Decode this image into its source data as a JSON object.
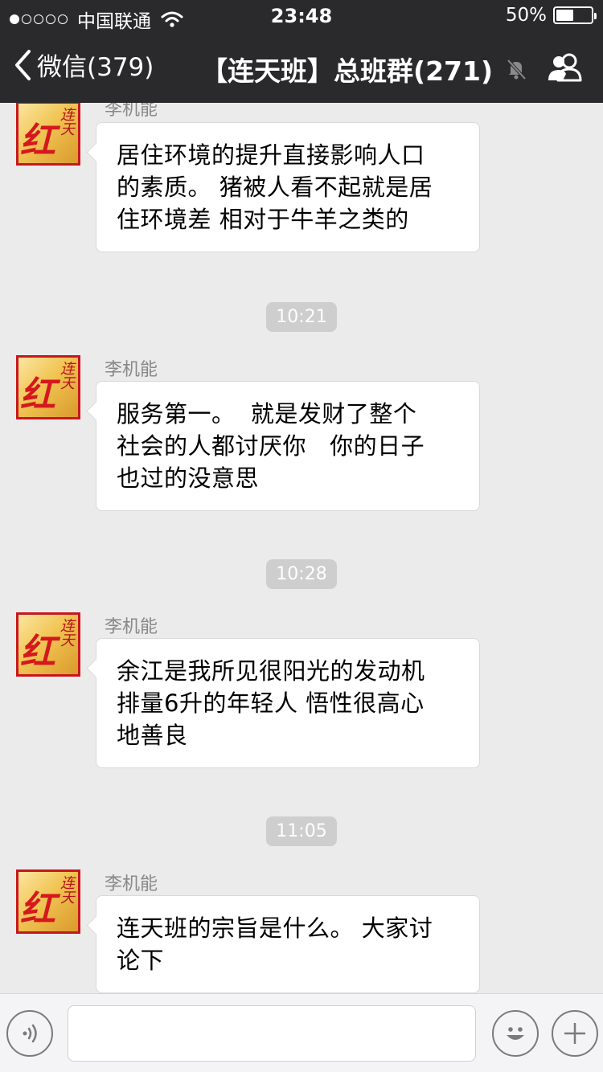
{
  "status_bar": {
    "signal_dots_filled": 1,
    "signal_dots_total": 5,
    "carrier": "中国联通",
    "time": "23:48",
    "battery_percent_text": "50%",
    "battery_level": 0.5
  },
  "nav": {
    "back_label": "微信(379)",
    "title": "【连天班】总班群(271)",
    "icons": [
      "chevron-left-icon",
      "mute-bell-icon",
      "group-members-icon"
    ]
  },
  "avatar": {
    "big_char": "红",
    "small_chars": "连天"
  },
  "timestamps": [
    "10:21",
    "10:28",
    "11:05"
  ],
  "messages": [
    {
      "sender": "李机能",
      "text": "居住环境的提升直接影响人口\n的素质。 猪被人看不起就是居\n住环境差 相对于牛羊之类的"
    },
    {
      "sender": "李机能",
      "text": "服务第一。  就是发财了整个\n社会的人都讨厌你   你的日子\n也过的没意思"
    },
    {
      "sender": "李机能",
      "text": "余江是我所见很阳光的发动机\n排量6升的年轻人 悟性很高心\n地善良"
    },
    {
      "sender": "李机能",
      "text": "连天班的宗旨是什么。 大家讨\n论下"
    }
  ],
  "input_bar": {
    "icons": [
      "voice-icon",
      "emoji-icon",
      "plus-icon"
    ],
    "text_value": ""
  },
  "colors": {
    "header_bg": "#2a2a2c",
    "chat_bg": "#ebebeb",
    "bubble_bg": "#ffffff",
    "time_pill_bg": "#cecece",
    "avatar_red": "#d4181e",
    "avatar_gold": "#f1c453"
  }
}
